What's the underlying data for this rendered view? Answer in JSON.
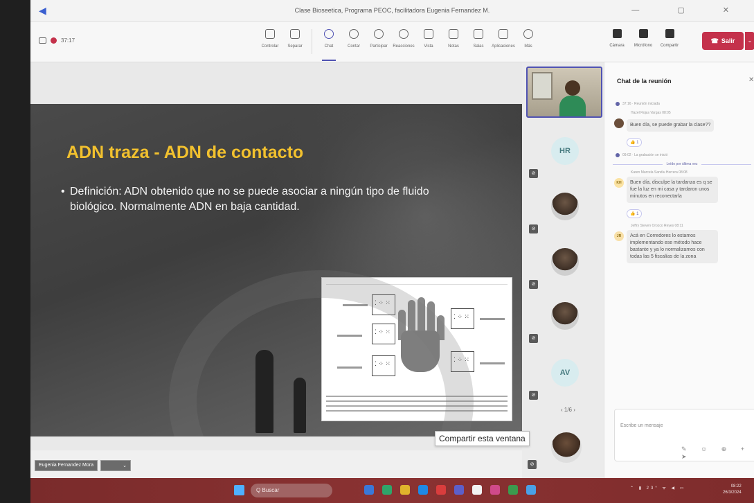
{
  "window": {
    "title": "Clase Bioseetica, Programa PEOC, facilitadora Eugenia Fernandez M.",
    "controls": "— ▢ ✕"
  },
  "toolbar": {
    "timer": "37:17",
    "tools": [
      {
        "label": "Controlar",
        "icon": "controller-icon"
      },
      {
        "label": "Separar",
        "icon": "pop-out-icon"
      },
      {
        "label": "Chat",
        "icon": "chat-icon",
        "active": true
      },
      {
        "label": "Contar",
        "icon": "people-icon"
      },
      {
        "label": "Participar",
        "icon": "raise-hand-icon"
      },
      {
        "label": "Reacciones",
        "icon": "emoji-icon"
      },
      {
        "label": "Vista",
        "icon": "view-icon"
      },
      {
        "label": "Notas",
        "icon": "notes-icon"
      },
      {
        "label": "Salas",
        "icon": "rooms-icon"
      },
      {
        "label": "Aplicaciones",
        "icon": "apps-icon"
      },
      {
        "label": "Más",
        "icon": "more-icon"
      }
    ],
    "devices": [
      {
        "label": "Cámara",
        "icon": "camera-off-icon"
      },
      {
        "label": "Micrófono",
        "icon": "mic-off-icon"
      },
      {
        "label": "Compartir",
        "icon": "share-icon"
      }
    ],
    "leave_label": "Salir"
  },
  "slide": {
    "title": "ADN traza - ADN de contacto",
    "bullet": "•",
    "body": "Definición: ADN obtenido que no se puede asociar a ningún tipo de fluido biológico. Normalmente ADN en baja cantidad."
  },
  "presenter": {
    "name": "Eugenia Fernandez Mora",
    "mic": "⌄"
  },
  "participants": {
    "tiles": [
      {
        "initials": "HR"
      },
      {
        "initials": ""
      },
      {
        "initials": ""
      },
      {
        "initials": ""
      },
      {
        "initials": "AV"
      }
    ],
    "pager": "‹  1/6  ›"
  },
  "tooltip": "Compartir esta ventana",
  "chat": {
    "header": "Chat de la reunión",
    "close": "✕",
    "messages_1": {
      "sys1": "37:16 · Reunión iniciada",
      "meta1": "Hazel Rojas Vargas 08:05",
      "text1": "Buen día, se puede grabar la clase??",
      "react1": "👍 1",
      "sys2": "09:02 · La grabación se inició",
      "divider": "Leído por última vez",
      "meta2": "Karen Marcela Sandiu Herrera 08:08",
      "avatar2": "KH",
      "text2": "Buen día, disculpe la tardanza es q se fue la luz en mi casa y tardaron unos minutos en reconectarla",
      "react2": "👍 1",
      "meta3": "Jeffry Steven Orozco Reyes 08:11",
      "avatar3": "JR",
      "text3": "Acá en Corredores lo estamos implementando ese método hace bastante y ya lo normalizamos con todas las 5 fiscalías de la zona"
    },
    "compose_placeholder": "Escribe un mensaje",
    "compose_actions": "✎ ☺ ⊕ + ➤"
  },
  "taskbar": {
    "search": "Q Buscar",
    "tray": "⌃ ▮ 23° ᯤ ◀ ▭",
    "time": "08:22",
    "date": "26/3/2024"
  },
  "colors": {
    "accent": "#4f52b2",
    "leave": "#c4314b",
    "slide_title": "#f2c12e",
    "taskbar": "#8a3232"
  }
}
